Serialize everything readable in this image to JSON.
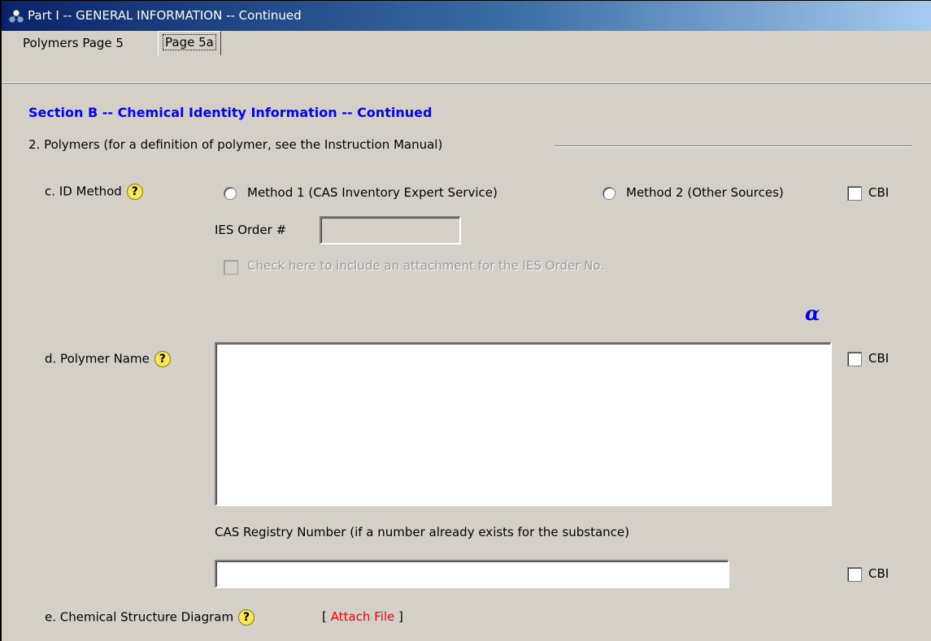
{
  "window": {
    "title": "Part I -- GENERAL INFORMATION -- Continued"
  },
  "tabs": [
    {
      "label": "Polymers Page 5"
    },
    {
      "label": "Page 5a"
    }
  ],
  "section": {
    "title": "Section B -- Chemical Identity Information -- Continued",
    "subtitle": "2. Polymers (for a definition of polymer, see the Instruction Manual)"
  },
  "id_method": {
    "label": "c. ID Method",
    "method1_label": "Method 1 (CAS Inventory Expert Service)",
    "method2_label": "Method 2 (Other Sources)",
    "cbi_label": "CBI",
    "ies_order_label": "IES Order #",
    "ies_order_value": "",
    "attachment_label": "Check here to include an attachment for the IES Order No."
  },
  "alpha_symbol": "α",
  "polymer_name": {
    "label": "d. Polymer Name",
    "value": "",
    "cbi_label": "CBI"
  },
  "cas": {
    "label": "CAS Registry Number (if a number already exists for the substance)",
    "value": "",
    "cbi_label": "CBI"
  },
  "structure": {
    "label": "e. Chemical Structure Diagram",
    "bracket_open": "[",
    "attach_label": "Attach File",
    "bracket_close": "]"
  },
  "help_glyph": "?"
}
